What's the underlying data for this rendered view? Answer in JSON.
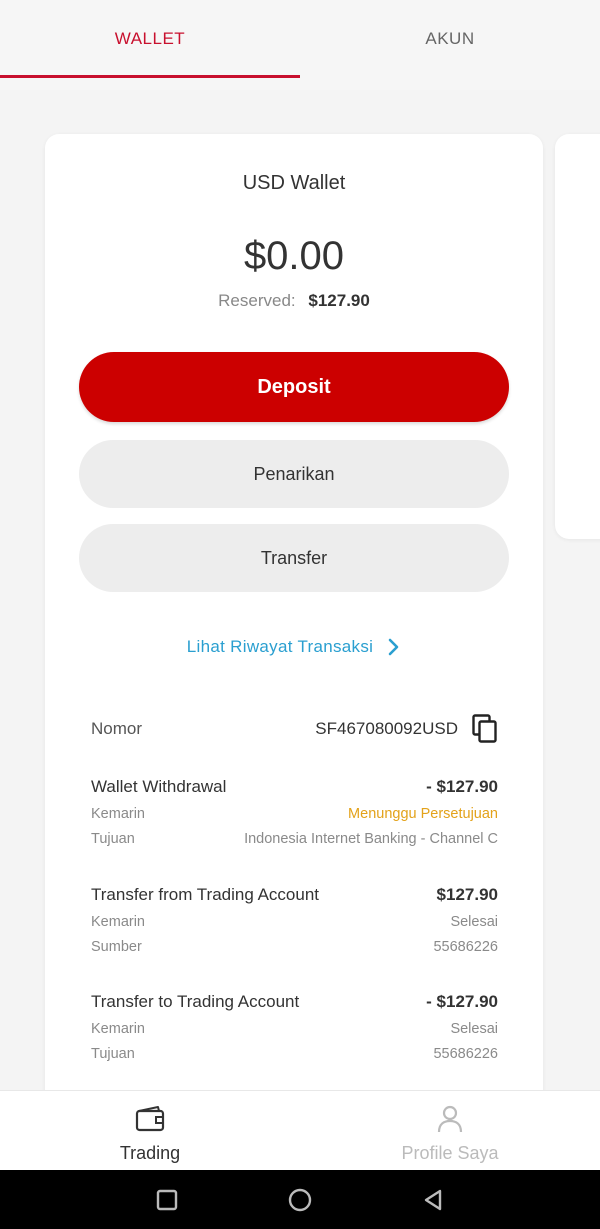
{
  "tabs": [
    {
      "label": "WALLET",
      "active": true
    },
    {
      "label": "AKUN",
      "active": false
    }
  ],
  "wallet": {
    "title": "USD Wallet",
    "balance": "$0.00",
    "reserved_label": "Reserved:",
    "reserved_value": "$127.90"
  },
  "actions": {
    "deposit": "Deposit",
    "withdraw": "Penarikan",
    "transfer": "Transfer"
  },
  "history_link": "Lihat Riwayat Transaksi",
  "account": {
    "label": "Nomor",
    "number": "SF467080092USD"
  },
  "transactions": [
    {
      "title": "Wallet Withdrawal",
      "amount": "- $127.90",
      "date": "Kemarin",
      "status": "Menunggu Persetujuan",
      "status_color": "#e3a21a",
      "detail_label": "Tujuan",
      "detail_value": "Indonesia Internet Banking - Channel C"
    },
    {
      "title": "Transfer from Trading Account",
      "amount": "$127.90",
      "date": "Kemarin",
      "status": "Selesai",
      "detail_label": "Sumber",
      "detail_value": "55686226"
    },
    {
      "title": "Transfer to Trading Account",
      "amount": "- $127.90",
      "date": "Kemarin",
      "status": "Selesai",
      "detail_label": "Tujuan",
      "detail_value": "55686226"
    }
  ],
  "bottom_nav": [
    {
      "label": "Trading",
      "icon": "wallet-icon",
      "active": true
    },
    {
      "label": "Profile Saya",
      "icon": "user-icon",
      "active": false
    }
  ],
  "system_nav": {
    "icons": [
      "square-icon",
      "circle-icon",
      "back-triangle-icon"
    ]
  },
  "colors": {
    "accent": "#c8102e",
    "deposit_button": "#cc0000",
    "link": "#2a9fd0",
    "pending": "#e3a21a"
  }
}
